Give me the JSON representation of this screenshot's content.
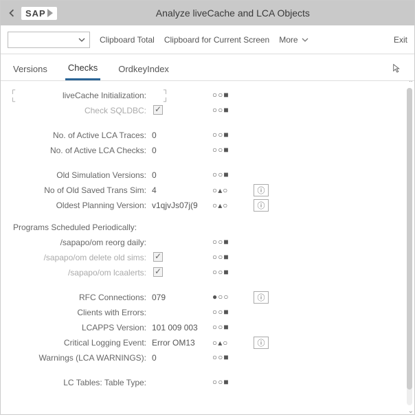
{
  "header": {
    "title": "Analyze liveCache and LCA Objects",
    "logo": "SAP"
  },
  "toolbar": {
    "dropdown_value": "",
    "clipboard_total": "Clipboard Total",
    "clipboard_current": "Clipboard for Current Screen",
    "more": "More",
    "exit": "Exit"
  },
  "tabs": {
    "versions": "Versions",
    "checks": "Checks",
    "ordkey": "OrdkeyIndex",
    "active": "checks"
  },
  "rows": {
    "init": {
      "label": "liveCache Initialization:",
      "value": "",
      "status": "○○■"
    },
    "sqldbc": {
      "label": "Check SQLDBC:",
      "checked": true,
      "status": "○○■"
    },
    "traces": {
      "label": "No. of Active LCA Traces:",
      "value": "0",
      "status": "○○■"
    },
    "checks": {
      "label": "No. of Active LCA Checks:",
      "value": "0",
      "status": "○○■"
    },
    "oldsim": {
      "label": "Old Simulation Versions:",
      "value": "0",
      "status": "○○■"
    },
    "savedtrans": {
      "label": "No of Old Saved Trans Sim:",
      "value": "4",
      "status": "○▴○",
      "info": true
    },
    "oldest": {
      "label": "Oldest Planning Version:",
      "value": "v1qjvJs07j(9",
      "status": "○▴○",
      "info": true
    },
    "section2": "Programs Scheduled Periodically:",
    "reorg": {
      "label": "/sapapo/om reorg daily:",
      "value": "",
      "status": "○○■"
    },
    "delold": {
      "label": "/sapapo/om delete old sims:",
      "checked": true,
      "status": "○○■"
    },
    "lcaalerts": {
      "label": "/sapapo/om lcaalerts:",
      "checked": true,
      "status": "○○■"
    },
    "rfc": {
      "label": "RFC Connections:",
      "value": "079",
      "status": "●○○",
      "info": true
    },
    "clients": {
      "label": "Clients with Errors:",
      "value": "",
      "status": "○○■"
    },
    "lcapps": {
      "label": "LCAPPS Version:",
      "value": "101 009 003",
      "status": "○○■"
    },
    "critlog": {
      "label": "Critical Logging Event:",
      "value": "Error OM13",
      "status": "○▴○",
      "info": true
    },
    "warnings": {
      "label": "Warnings (LCA WARNINGS):",
      "value": "0",
      "status": "○○■"
    },
    "lctables": {
      "label": "LC Tables: Table Type:",
      "value": "",
      "status": "○○■"
    }
  },
  "icons": {
    "info_glyph": "ⓘ"
  }
}
